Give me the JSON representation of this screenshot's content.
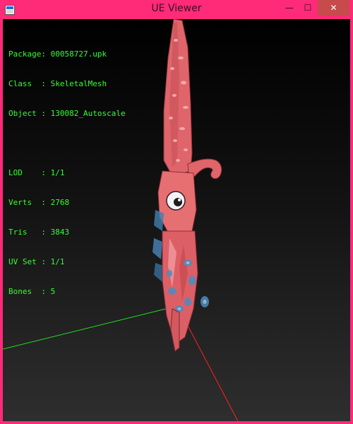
{
  "window": {
    "title": "UE Viewer",
    "controls": {
      "minimize": "—",
      "maximize": "☐",
      "close": "✕"
    }
  },
  "info": {
    "package": {
      "label": "Package",
      "value": "00058727.upk"
    },
    "class": {
      "label": "Class  ",
      "value": "SkeletalMesh"
    },
    "object": {
      "label": "Object ",
      "value": "130082_Autoscale"
    },
    "lod": {
      "label": "LOD    ",
      "value": "1/1"
    },
    "verts": {
      "label": "Verts  ",
      "value": "2768"
    },
    "tris": {
      "label": "Tris   ",
      "value": "3843"
    },
    "uvset": {
      "label": "UV Set ",
      "value": "1/1"
    },
    "bones": {
      "label": "Bones  ",
      "value": "5"
    }
  },
  "colors": {
    "frame": "#ff2a78",
    "info_text": "#33ff33",
    "axis_x": "#ff2020",
    "axis_y": "#22dd22",
    "squid_body": "#e0656a"
  },
  "icons": {
    "app": "ue-viewer-app-icon"
  }
}
